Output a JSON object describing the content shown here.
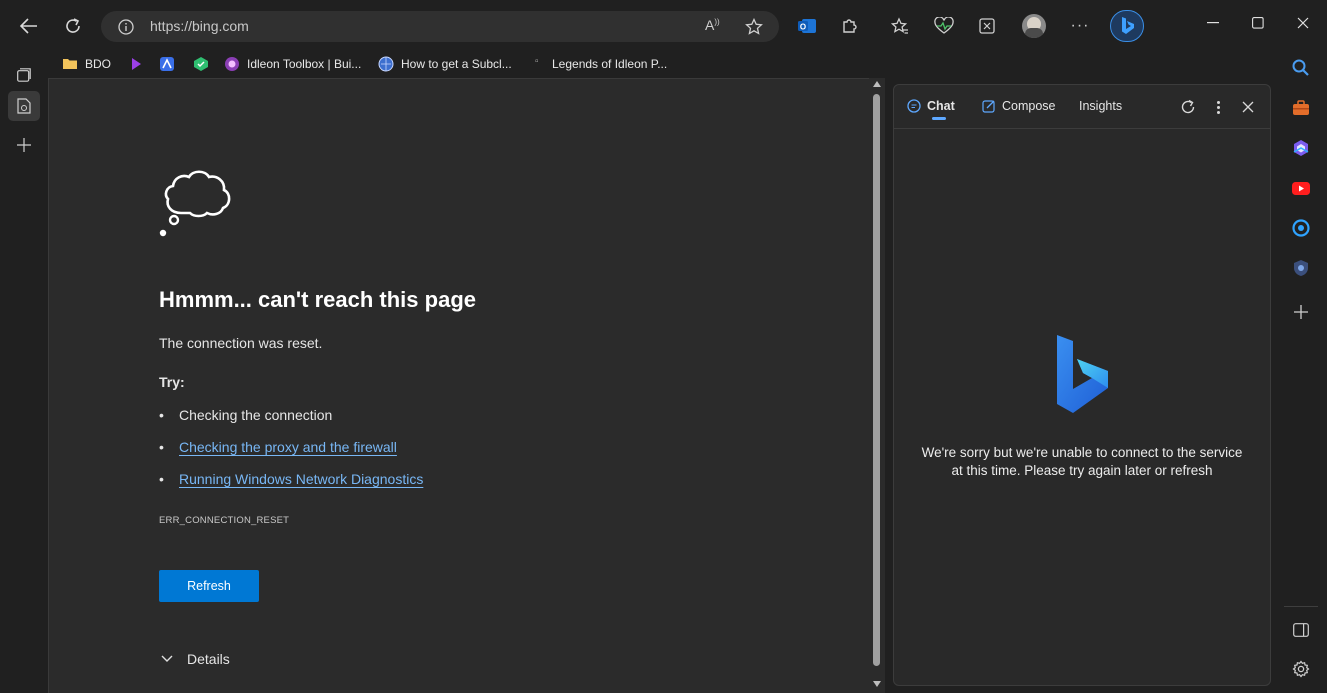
{
  "browser": {
    "url": "https://bing.com"
  },
  "bookmarks": [
    {
      "label": "BDO"
    },
    {
      "label": ""
    },
    {
      "label": ""
    },
    {
      "label": ""
    },
    {
      "label": "Idleon Toolbox | Bui..."
    },
    {
      "label": "How to get a Subcl..."
    },
    {
      "label": "Legends of Idleon P..."
    }
  ],
  "error_page": {
    "heading": "Hmmm... can't reach this page",
    "message": "The connection was reset.",
    "try_label": "Try:",
    "suggestions": [
      {
        "text": "Checking the connection",
        "is_link": false
      },
      {
        "text": "Checking the proxy and the firewall",
        "is_link": true
      },
      {
        "text": "Running Windows Network Diagnostics",
        "is_link": true
      }
    ],
    "error_code": "ERR_CONNECTION_RESET",
    "refresh_label": "Refresh",
    "details_label": "Details"
  },
  "sidebar_panel": {
    "tabs": [
      {
        "label": "Chat",
        "active": true
      },
      {
        "label": "Compose",
        "active": false
      },
      {
        "label": "Insights",
        "active": false
      }
    ],
    "error_line1": "We're sorry but we're unable to connect to the service",
    "error_line2": "at this time. Please try again later or refresh"
  },
  "colors": {
    "accent_blue": "#0078d4",
    "link_blue": "#78b7f5",
    "page_bg": "#2b2b2b",
    "chrome_bg": "#202020"
  }
}
